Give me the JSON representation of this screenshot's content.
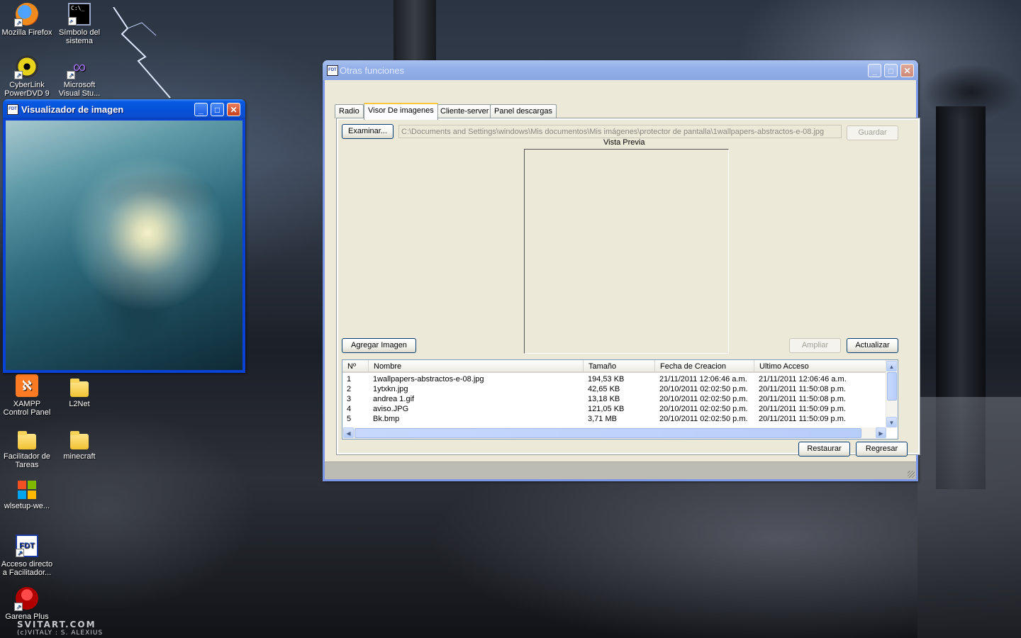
{
  "desktop": {
    "icons": [
      {
        "label": "Mozilla Firefox",
        "icon": "firefox-icon"
      },
      {
        "label": "Símbolo del sistema",
        "icon": "cmd-icon"
      },
      {
        "label": "CyberLink PowerDVD 9",
        "icon": "powerdvd-icon"
      },
      {
        "label": "Microsoft Visual Stu...",
        "icon": "visual-studio-icon"
      },
      {
        "label": "XAMPP Control Panel",
        "icon": "xampp-icon"
      },
      {
        "label": "L2Net",
        "icon": "folder-icon"
      },
      {
        "label": "Facilitador de Tareas",
        "icon": "folder-icon"
      },
      {
        "label": "minecraft",
        "icon": "folder-icon"
      },
      {
        "label": "wlsetup-we...",
        "icon": "windows-logo-icon"
      },
      {
        "label": "Acceso directo a Facilitador...",
        "icon": "fdt-icon"
      },
      {
        "label": "Garena Plus",
        "icon": "garena-icon"
      }
    ],
    "watermark": "SVITART.COM",
    "watermark_sub": "(c)VITALY : S. ALEXIUS"
  },
  "image_viewer": {
    "title": "Visualizador de imagen",
    "app_icon": "FDT"
  },
  "main_window": {
    "title": "Otras funciones",
    "app_icon": "FDT",
    "tabs": [
      "Radio",
      "Visor De imagenes",
      "Cliente-server",
      "Panel descargas"
    ],
    "active_tab": 1,
    "browse_label": "Examinar...",
    "path_value": "C:\\Documents and Settings\\windows\\Mis documentos\\Mis imágenes\\protector de pantalla\\1wallpapers-abstractos-e-08.jpg",
    "save_label": "Guardar",
    "preview_label": "Vista Previa",
    "add_image_label": "Agregar Imagen",
    "zoom_label": "Ampliar",
    "refresh_label": "Actualizar",
    "restore_label": "Restaurar",
    "back_label": "Regresar",
    "table": {
      "columns": [
        "Nº",
        "Nombre",
        "Tamaño",
        "Fecha de Creacion",
        "Ultimo Acceso"
      ],
      "rows": [
        [
          "1",
          "1wallpapers-abstractos-e-08.jpg",
          "194,53 KB",
          "21/11/2011 12:06:46 a.m.",
          "21/11/2011 12:06:46 a.m."
        ],
        [
          "2",
          "1ytxkn.jpg",
          "42,65 KB",
          "20/10/2011 02:02:50 p.m.",
          "20/11/2011 11:50:08 p.m."
        ],
        [
          "3",
          "andrea 1.gif",
          "13,18 KB",
          "20/10/2011 02:02:50 p.m.",
          "20/11/2011 11:50:08 p.m."
        ],
        [
          "4",
          "aviso.JPG",
          "121,05 KB",
          "20/10/2011 02:02:50 p.m.",
          "20/11/2011 11:50:09 p.m."
        ],
        [
          "5",
          "Bk.bmp",
          "3,71 MB",
          "20/10/2011 02:02:50 p.m.",
          "20/11/2011 11:50:09 p.m."
        ]
      ]
    }
  }
}
